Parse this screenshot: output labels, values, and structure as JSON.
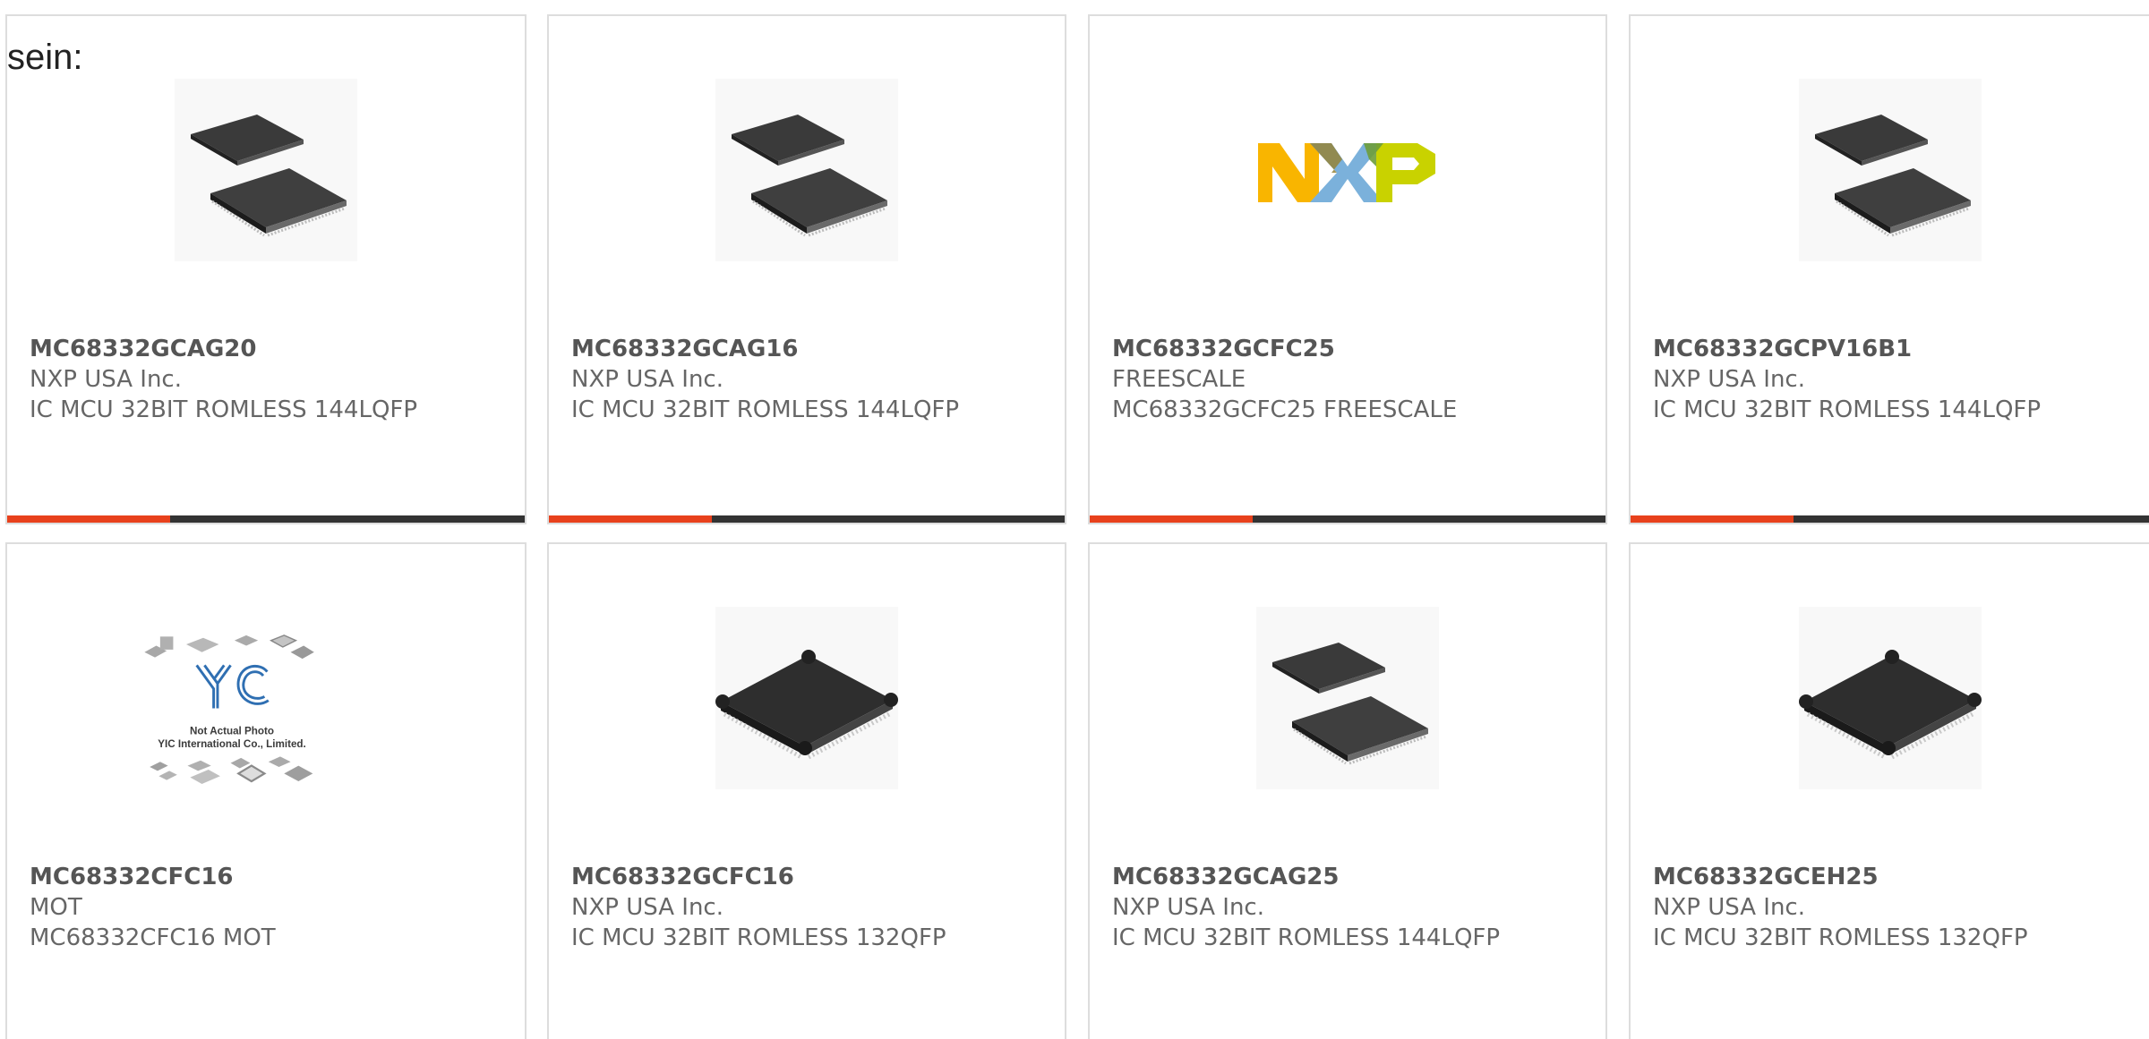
{
  "lead_text": "sein:",
  "products": [
    {
      "part": "MC68332GCAG20",
      "maker": "NXP USA Inc.",
      "desc": "IC MCU 32BIT ROMLESS 144LQFP",
      "image": "lqfp-chip-pair"
    },
    {
      "part": "MC68332GCAG16",
      "maker": "NXP USA Inc.",
      "desc": "IC MCU 32BIT ROMLESS 144LQFP",
      "image": "lqfp-chip-pair"
    },
    {
      "part": "MC68332GCFC25",
      "maker": "FREESCALE",
      "desc": "MC68332GCFC25 FREESCALE",
      "image": "nxp-logo"
    },
    {
      "part": "MC68332GCPV16B1",
      "maker": "NXP USA Inc.",
      "desc": "IC MCU 32BIT ROMLESS 144LQFP",
      "image": "lqfp-chip-pair"
    },
    {
      "part": "MC68332CFC16",
      "maker": "MOT",
      "desc": "MC68332CFC16 MOT",
      "image": "placeholder-yic",
      "placeholder_lines": [
        "Not Actual Photo",
        "YIC International Co., Limited."
      ]
    },
    {
      "part": "MC68332GCFC16",
      "maker": "NXP USA Inc.",
      "desc": "IC MCU 32BIT ROMLESS 132QFP",
      "image": "qfp-chip"
    },
    {
      "part": "MC68332GCAG25",
      "maker": "NXP USA Inc.",
      "desc": "IC MCU 32BIT ROMLESS 144LQFP",
      "image": "lqfp-chip-pair"
    },
    {
      "part": "MC68332GCEH25",
      "maker": "NXP USA Inc.",
      "desc": "IC MCU 32BIT ROMLESS 132QFP",
      "image": "qfp-chip"
    }
  ],
  "colors": {
    "accent": "#e8411c",
    "bar": "#333333",
    "border": "#dddddd",
    "text": "#666666"
  }
}
